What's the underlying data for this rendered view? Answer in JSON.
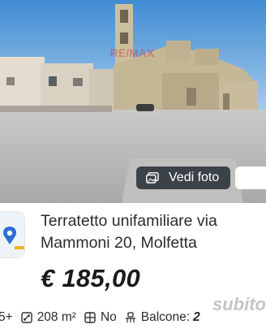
{
  "photo": {
    "watermark_text": "RE/MAX",
    "colors": {
      "sky": "#4a93d6",
      "stone": "#c7b89a",
      "pavement": "#bdbdbd"
    }
  },
  "gallery_button": {
    "label": "Vedi foto",
    "icon": "photo-icon"
  },
  "listing": {
    "title_line1": "Terratetto unifamiliare via",
    "title_line2": "Mammoni 20, Molfetta",
    "price": "€ 185,00"
  },
  "features": {
    "rooms": "5+",
    "area": "208 m²",
    "garden": "No",
    "balcony_label": "Balcone:",
    "balcony_value": "2"
  },
  "overlay_watermark": "subito"
}
